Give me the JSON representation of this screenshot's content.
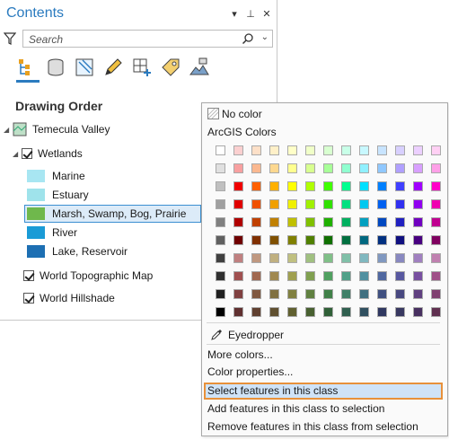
{
  "pane": {
    "title": "Contents",
    "header_icons": {
      "menu": "▾",
      "pin": "⊥",
      "close": "✕"
    },
    "search_placeholder": "Search",
    "section_title": "Drawing Order",
    "map_name": "Temecula Valley",
    "layers": [
      {
        "name": "Wetlands",
        "checked": true,
        "classes": [
          {
            "label": "Marine",
            "color": "#a8e6f2"
          },
          {
            "label": "Estuary",
            "color": "#9fe3eb"
          },
          {
            "label": "Marsh, Swamp, Bog, Prairie",
            "color": "#6fb84c",
            "selected": true
          },
          {
            "label": "River",
            "color": "#1a9bd6"
          },
          {
            "label": "Lake, Reservoir",
            "color": "#1d6fb3"
          }
        ]
      },
      {
        "name": "World Topographic Map",
        "checked": true
      },
      {
        "name": "World Hillshade",
        "checked": true
      }
    ]
  },
  "menu": {
    "no_color": "No color",
    "palette_title": "ArcGIS Colors",
    "eyedropper": "Eyedropper",
    "more_colors": "More colors...",
    "color_properties": "Color properties...",
    "select_features": "Select features in this class",
    "add_features": "Add features in this class to selection",
    "remove_features": "Remove features in this class from selection"
  },
  "palette_rows": [
    [
      "#ffffff",
      "#fbd0d0",
      "#fde0c8",
      "#fff0c8",
      "#ffffc8",
      "#f0ffc8",
      "#d8ffd0",
      "#c8ffe8",
      "#c8f8ff",
      "#c8e4ff",
      "#d8d0ff",
      "#ecd0ff",
      "#ffd0f4"
    ],
    [
      "#e0e0e0",
      "#f8a0a0",
      "#fbb890",
      "#fdd890",
      "#ffff90",
      "#d8ff90",
      "#a8ff98",
      "#90ffd0",
      "#90f0ff",
      "#90c8ff",
      "#b0a0ff",
      "#d8a0ff",
      "#ffa0e8"
    ],
    [
      "#c0c0c0",
      "#f00000",
      "#ff6000",
      "#ffb000",
      "#ffff00",
      "#b0ff00",
      "#40ff00",
      "#00ff90",
      "#00e0ff",
      "#0080ff",
      "#4040ff",
      "#a000ff",
      "#ff00c8"
    ],
    [
      "#a0a0a0",
      "#e00000",
      "#f05000",
      "#f0a000",
      "#f0f000",
      "#a0f000",
      "#30e000",
      "#00e080",
      "#00c8f0",
      "#0060f0",
      "#3030f0",
      "#9000f0",
      "#f000b0"
    ],
    [
      "#808080",
      "#b00000",
      "#c04000",
      "#c08000",
      "#c0c000",
      "#80c000",
      "#20b000",
      "#00b060",
      "#00a0c0",
      "#0048c0",
      "#2020c0",
      "#7000c0",
      "#c00090"
    ],
    [
      "#606060",
      "#700000",
      "#803000",
      "#805000",
      "#808000",
      "#508000",
      "#107000",
      "#007040",
      "#006880",
      "#003080",
      "#101080",
      "#480080",
      "#800060"
    ],
    [
      "#404040",
      "#c08080",
      "#c09880",
      "#c0b080",
      "#c0c080",
      "#a0c080",
      "#80c088",
      "#80c0a8",
      "#80b8c0",
      "#8098c0",
      "#8888c0",
      "#a080c0",
      "#c080b0"
    ],
    [
      "#303030",
      "#a05050",
      "#a06850",
      "#a08850",
      "#a0a050",
      "#80a050",
      "#50a060",
      "#50a088",
      "#5090a0",
      "#5068a0",
      "#5858a0",
      "#7850a0",
      "#a05088"
    ],
    [
      "#202020",
      "#804040",
      "#805840",
      "#807040",
      "#808040",
      "#608040",
      "#408048",
      "#408068",
      "#407080",
      "#405080",
      "#484880",
      "#604080",
      "#804070"
    ],
    [
      "#000000",
      "#603030",
      "#604030",
      "#605030",
      "#606030",
      "#486030",
      "#306038",
      "#306050",
      "#305060",
      "#303860",
      "#383860",
      "#483060",
      "#603050"
    ]
  ]
}
